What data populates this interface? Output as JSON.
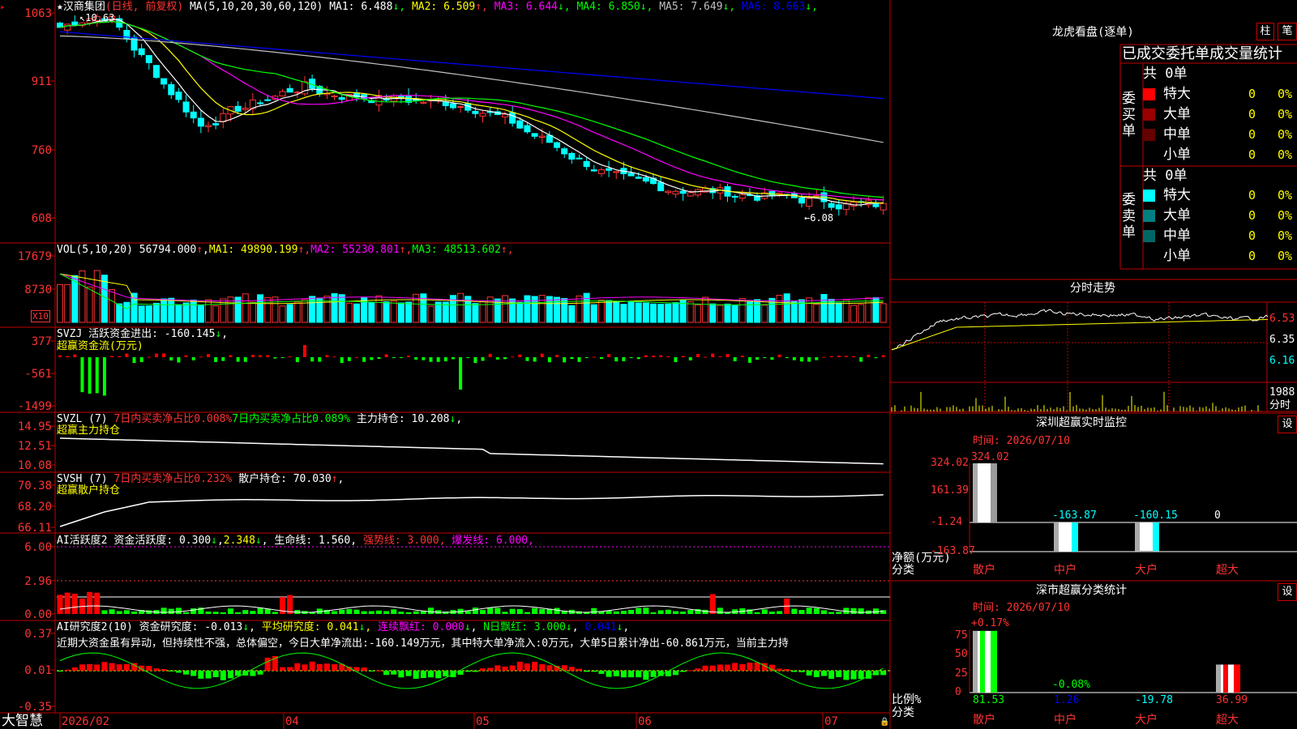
{
  "app": {
    "name": "大智慧"
  },
  "main": {
    "star": "★",
    "stock_name": "汉商集团",
    "period": "(日线, 前复权)",
    "ma_label": "MA(5,10,20,30,60,120)",
    "ma": [
      {
        "label": "MA1:",
        "value": "6.488",
        "arrow": "↓",
        "color": "#ffffff"
      },
      {
        "label": "MA2:",
        "value": "6.509",
        "arrow": "↑",
        "color": "#ffff00"
      },
      {
        "label": "MA3:",
        "value": "6.644",
        "arrow": "↓",
        "color": "#ff00ff"
      },
      {
        "label": "MA4:",
        "value": "6.850",
        "arrow": "↓",
        "color": "#00ff00"
      },
      {
        "label": "MA5:",
        "value": "7.649",
        "arrow": "↓",
        "color": "#c0c0c0"
      },
      {
        "label": "MA6:",
        "value": "8.663",
        "arrow": "↓",
        "color": "#0000ff"
      }
    ],
    "y_ticks": [
      "1063",
      "911",
      "760",
      "608"
    ],
    "high_label": "10.63",
    "low_label": "←6.08"
  },
  "vol": {
    "label": "VOL(5,10,20)",
    "value": "56794.000",
    "items": [
      {
        "label": "MA1:",
        "value": "49890.199",
        "arrow": "↑",
        "color": "#ffff00"
      },
      {
        "label": "MA2:",
        "value": "55230.801",
        "arrow": "↑",
        "color": "#ff00ff"
      },
      {
        "label": "MA3:",
        "value": "48513.602",
        "arrow": "↑",
        "color": "#00ff00"
      }
    ],
    "y_ticks": [
      "17679",
      "8730"
    ],
    "unit": "X10"
  },
  "svzj": {
    "label": "SVZJ",
    "item": "活跃资金进出:",
    "value": "-160.145",
    "arrow": "↓",
    "sub": "超赢资金流(万元)",
    "y_ticks": [
      "377",
      "-561",
      "-1499"
    ]
  },
  "svzl": {
    "label": "SVZL (7)",
    "red_text": "7日内买卖净占比0.008%",
    "green_text": "7日内买卖净占比0.089%",
    "main_label": "主力持仓:",
    "main_value": "10.208",
    "arrow": "↓",
    "sub": "超赢主力持仓",
    "y_ticks": [
      "14.95",
      "12.51",
      "10.08"
    ]
  },
  "svsh": {
    "label": "SVSH (7)",
    "red_text": "7日内买卖净占比0.232%",
    "main_label": "散户持仓:",
    "main_value": "70.030",
    "arrow": "↑",
    "sub": "超赢散户持仓",
    "y_ticks": [
      "70.38",
      "68.20",
      "66.11"
    ]
  },
  "ai_active": {
    "label": "AI活跃度2",
    "item": "资金活跃度:",
    "value": "0.300",
    "value2": "2.348",
    "life": "生命线:",
    "life_value": "1.560",
    "strong": "强势线:",
    "strong_value": "3.000",
    "burst": "爆发线:",
    "burst_value": "6.000",
    "y_ticks": [
      "6.00",
      "2.96",
      "0.00"
    ]
  },
  "ai_research": {
    "label": "AI研究度2(10)",
    "item": "资金研究度:",
    "value": "-0.013",
    "avg": "平均研究度:",
    "avg_value": "0.041",
    "lian": "连续飘红:",
    "lian_value": "0.000",
    "nday": "N日飘红:",
    "nday_value": "3.000",
    "last_value": "0.041",
    "comment": "近期大资金虽有异动，但持续性不强，总体偏空，今日大单净流出:-160.149万元，其中特大单净流入:0万元，大单5日累计净出-60.861万元，当前主力持",
    "y_ticks": [
      "0.37",
      "0.01",
      "-0.35"
    ]
  },
  "x_axis": [
    "2026/02",
    "04",
    "05",
    "06",
    "07"
  ],
  "right": {
    "panel_title": "龙虎看盘(逐单)",
    "btn_zhu": "柱",
    "btn_bi": "笔",
    "stats_title": "已成交委托单成交量统计",
    "buy_label": [
      "委",
      "买",
      "单"
    ],
    "sell_label": [
      "委",
      "卖",
      "单"
    ],
    "buy_total": "共 0单",
    "sell_total": "共 0单",
    "buy_rows": [
      {
        "name": "特大",
        "count": "0",
        "pct": "0%",
        "color": "#ff0000"
      },
      {
        "name": "大单",
        "count": "0",
        "pct": "0%",
        "color": "#990000"
      },
      {
        "name": "中单",
        "count": "0",
        "pct": "0%",
        "color": "#660000"
      },
      {
        "name": "小单",
        "count": "0",
        "pct": "0%",
        "color": ""
      }
    ],
    "sell_rows": [
      {
        "name": "特大",
        "count": "0",
        "pct": "0%",
        "color": "#00ffff"
      },
      {
        "name": "大单",
        "count": "0",
        "pct": "0%",
        "color": "#008080"
      },
      {
        "name": "中单",
        "count": "0",
        "pct": "0%",
        "color": "#006666"
      },
      {
        "name": "小单",
        "count": "0",
        "pct": "0%",
        "color": ""
      }
    ],
    "intraday": {
      "title": "分时走势",
      "y_ticks": [
        "6.53",
        "6.35",
        "6.16"
      ],
      "vol_tick": "1988",
      "vol_unit": "分时"
    },
    "sz_monitor": {
      "title": "深圳超赢实时监控",
      "btn": "设",
      "time": "时间: 2026/07/10",
      "y_ticks": [
        "324.02",
        "161.39",
        "-1.24",
        "-163.87"
      ],
      "ylabel": "净额(万元)",
      "xlabel": "分类",
      "categories": [
        "散户",
        "中户",
        "大户",
        "超大"
      ],
      "values": [
        324.02,
        -163.87,
        -160.15,
        0
      ],
      "value_labels": [
        "324.02",
        "-163.87",
        "-160.15",
        "0"
      ]
    },
    "sz_class": {
      "title": "深市超赢分类统计",
      "btn": "设",
      "time": "时间: 2026/07/10",
      "y_ticks": [
        "75",
        "50",
        "25",
        "0"
      ],
      "ylabel": "比例%",
      "xlabel": "分类",
      "categories": [
        "散户",
        "中户",
        "大户",
        "超大"
      ],
      "values": [
        81.53,
        1.26,
        -19.78,
        36.99
      ],
      "top_labels": [
        "+0.17%",
        "-0.08%"
      ],
      "bottom_labels": [
        "81.53",
        "1.26",
        "-19.78",
        "36.99"
      ]
    }
  },
  "chart_data": [
    {
      "type": "bar",
      "title": "深圳超赢实时监控",
      "categories": [
        "散户",
        "中户",
        "大户",
        "超大"
      ],
      "values": [
        324.02,
        -163.87,
        -160.15,
        0
      ],
      "ylabel": "净额(万元)",
      "xlabel": "分类",
      "ylim": [
        -163.87,
        324.02
      ]
    },
    {
      "type": "bar",
      "title": "深市超赢分类统计",
      "categories": [
        "散户",
        "中户",
        "大户",
        "超大"
      ],
      "values": [
        81.53,
        1.26,
        -19.78,
        36.99
      ],
      "ylabel": "比例%",
      "xlabel": "分类",
      "ylim": [
        0,
        75
      ]
    }
  ]
}
